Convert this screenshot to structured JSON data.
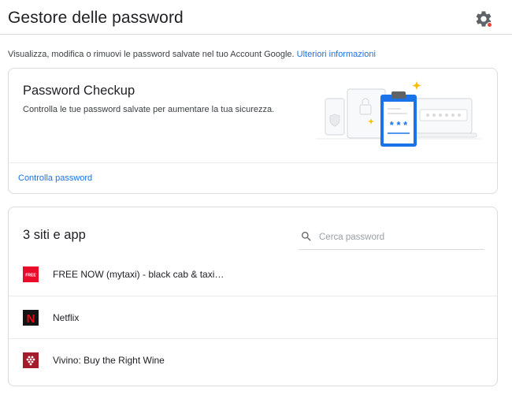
{
  "header": {
    "title": "Gestore delle password",
    "settings_icon": "gear-icon",
    "notification_dot_color": "#ea4335"
  },
  "intro": {
    "text": "Visualizza, modifica o rimuovi le password salvate nel tuo Account Google.",
    "link": "Ulteriori informazioni"
  },
  "checkup": {
    "title": "Password Checkup",
    "description": "Controlla le tue password salvate per aumentare la tua sicurezza.",
    "action_link": "Controlla password",
    "illustration_mask": "* * *"
  },
  "sites": {
    "title": "3 siti e app",
    "search_placeholder": "Cerca password",
    "items": [
      {
        "name": "FREE NOW (mytaxi) - black cab & taxi…",
        "icon": "free-now-icon",
        "icon_text": "FREE",
        "color": "#ea0a2a"
      },
      {
        "name": "Netflix",
        "icon": "netflix-icon",
        "icon_text": "N",
        "color": "#e50914"
      },
      {
        "name": "Vivino: Buy the Right Wine",
        "icon": "vivino-icon",
        "color": "#a41c2c"
      }
    ]
  },
  "colors": {
    "accent": "#1a73e8",
    "text": "#202124",
    "border": "#dadce0"
  }
}
